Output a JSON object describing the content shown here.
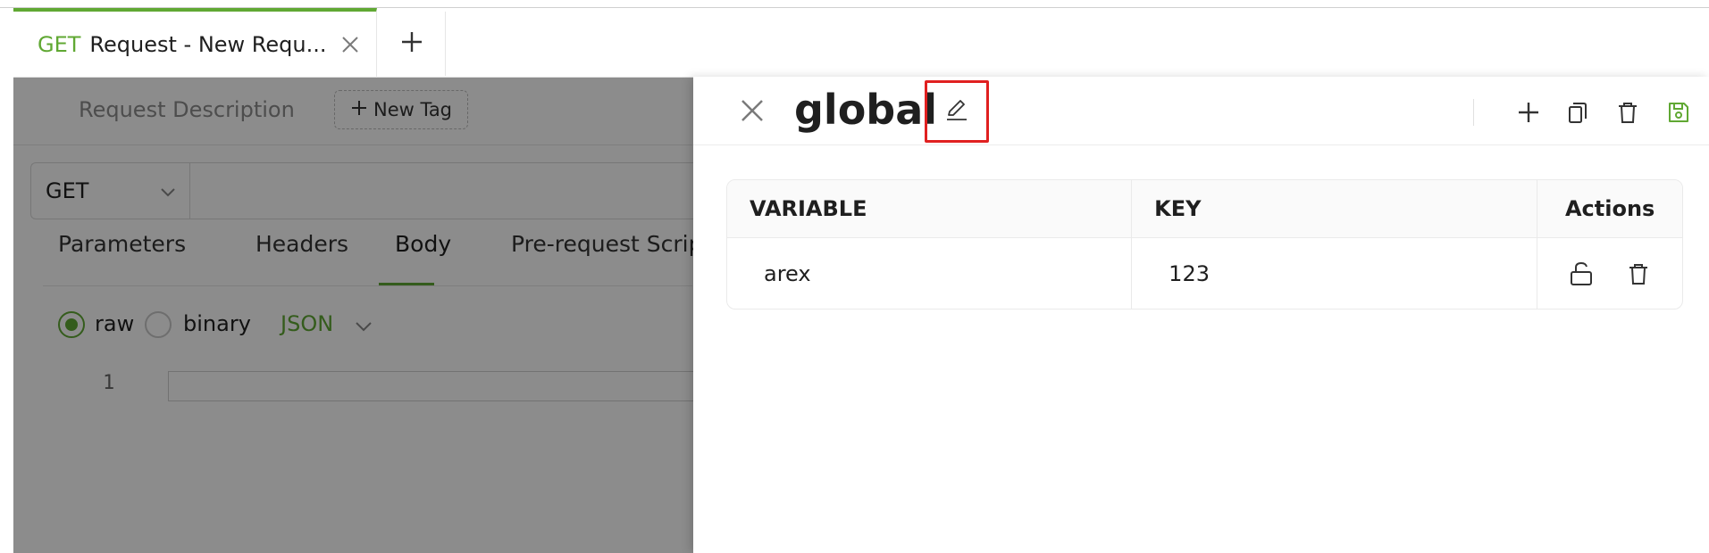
{
  "tab": {
    "method": "GET",
    "title": "Request - New Requ..."
  },
  "request": {
    "description_label": "Request Description",
    "new_tag_label": "New Tag",
    "method": "GET",
    "tabs": [
      {
        "label": "Parameters"
      },
      {
        "label": "Headers"
      },
      {
        "label": "Body"
      },
      {
        "label": "Pre-request Script"
      }
    ],
    "active_tab": "Body",
    "body_options": {
      "raw": "raw",
      "binary": "binary",
      "format": "JSON"
    },
    "editor_line_number": "1"
  },
  "environment": {
    "name": "global",
    "columns": {
      "variable": "VARIABLE",
      "key": "KEY",
      "actions": "Actions"
    },
    "rows": [
      {
        "variable": "arex",
        "key": "123"
      }
    ]
  },
  "colors": {
    "accent": "#60a833",
    "highlight": "#e02020"
  }
}
